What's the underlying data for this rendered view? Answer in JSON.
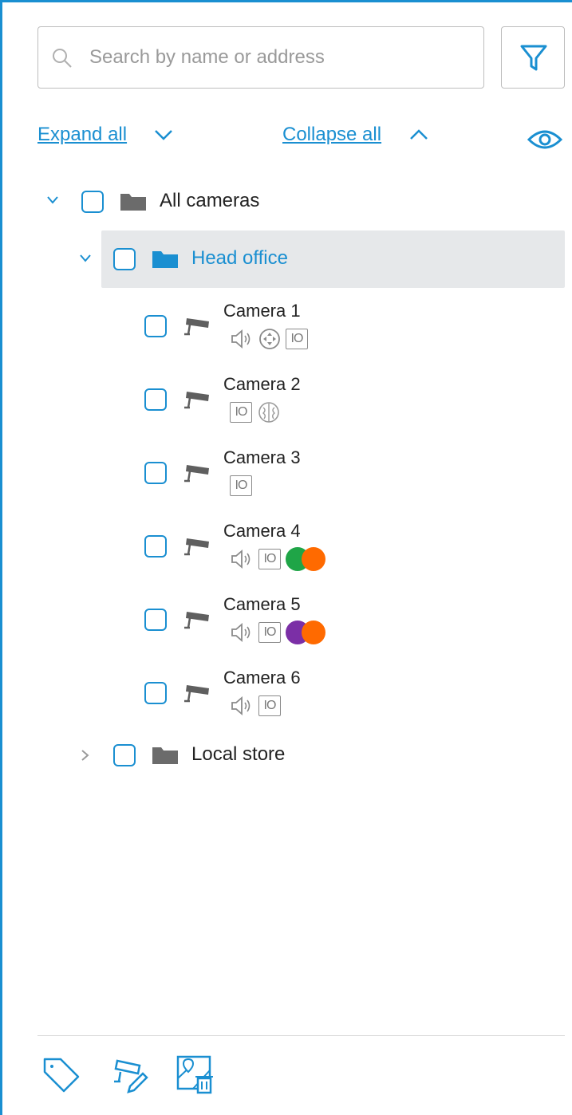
{
  "search": {
    "placeholder": "Search by name or address",
    "value": ""
  },
  "links": {
    "expand_all": "Expand all",
    "collapse_all": "Collapse all"
  },
  "colors": {
    "accent": "#1a8fd1",
    "selection": "#e6e8ea",
    "green": "#1fa547",
    "orange": "#ff6a00",
    "purple": "#7b2fa6",
    "folder_gray": "#6b6b6b"
  },
  "tree": {
    "root": {
      "label": "All cameras",
      "expanded": true
    },
    "head_office": {
      "label": "Head office",
      "expanded": true,
      "selected": true
    },
    "cameras": [
      {
        "name": "Camera 1",
        "capabilities": [
          "speaker-icon",
          "ptz-icon",
          "io-badge"
        ]
      },
      {
        "name": "Camera 2",
        "capabilities": [
          "io-badge",
          "brain-icon"
        ]
      },
      {
        "name": "Camera 3",
        "capabilities": [
          "io-badge"
        ]
      },
      {
        "name": "Camera 4",
        "capabilities": [
          "speaker-icon",
          "io-badge",
          "green-status-dot",
          "orange-status-dot"
        ]
      },
      {
        "name": "Camera 5",
        "capabilities": [
          "speaker-icon",
          "io-badge",
          "purple-status-dot",
          "orange-status-dot"
        ]
      },
      {
        "name": "Camera 6",
        "capabilities": [
          "speaker-icon",
          "io-badge"
        ]
      }
    ],
    "local_store": {
      "label": "Local store",
      "expanded": false
    }
  },
  "io_badge_text": "IO",
  "bottom_toolbar": [
    "tag-icon",
    "camera-edit-icon",
    "map-delete-icon"
  ]
}
